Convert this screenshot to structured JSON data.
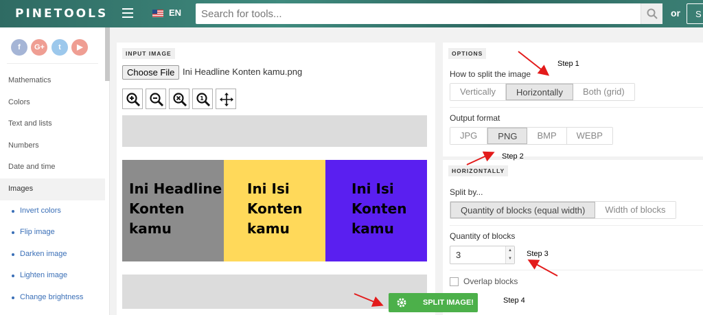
{
  "header": {
    "logo": "PINETOOLS",
    "language": "EN",
    "search_placeholder": "Search for tools...",
    "or_label": "or",
    "signup_label": "S"
  },
  "sidebar": {
    "socials": [
      {
        "name": "facebook",
        "glyph": "f"
      },
      {
        "name": "google-plus",
        "glyph": "G+"
      },
      {
        "name": "twitter",
        "glyph": "t"
      },
      {
        "name": "youtube",
        "glyph": "▶"
      }
    ],
    "items": [
      {
        "label": "Mathematics"
      },
      {
        "label": "Colors"
      },
      {
        "label": "Text and lists"
      },
      {
        "label": "Numbers"
      },
      {
        "label": "Date and time"
      },
      {
        "label": "Images"
      },
      {
        "label": "Invert colors"
      },
      {
        "label": "Flip image"
      },
      {
        "label": "Darken image"
      },
      {
        "label": "Lighten image"
      },
      {
        "label": "Change brightness"
      }
    ]
  },
  "input": {
    "section_title": "INPUT IMAGE",
    "choose_file": "Choose File",
    "file_name": "Ini Headline Konten kamu.png",
    "tools": [
      "zoom-in-icon",
      "zoom-out-icon",
      "zoom-reset-icon",
      "zoom-fit-icon",
      "move-icon"
    ],
    "preview_blocks": [
      {
        "lines": [
          "Ini Headline",
          "Konten",
          "kamu"
        ],
        "color": "#8c8c8c"
      },
      {
        "lines": [
          "Ini Isi",
          "Konten",
          "kamu"
        ],
        "color": "#ffd95a"
      },
      {
        "lines": [
          "Ini Isi",
          "Konten",
          "kamu"
        ],
        "color": "#5a1ff0"
      }
    ]
  },
  "options": {
    "section_title": "OPTIONS",
    "split_label": "How to split the image",
    "split_options": [
      "Vertically",
      "Horizontally",
      "Both (grid)"
    ],
    "split_selected": "Horizontally",
    "format_label": "Output format",
    "format_options": [
      "JPG",
      "PNG",
      "BMP",
      "WEBP"
    ],
    "format_selected": "PNG"
  },
  "horizontally": {
    "section_title": "HORIZONTALLY",
    "split_by_label": "Split by...",
    "split_by_options": [
      "Quantity of blocks (equal width)",
      "Width of blocks"
    ],
    "split_by_selected": "Quantity of blocks (equal width)",
    "qty_label": "Quantity of blocks",
    "qty_value": "3",
    "overlap_label": "Overlap blocks"
  },
  "action": {
    "split_label": "SPLIT IMAGE!"
  },
  "steps": [
    "Step 1",
    "Step 2",
    "Step 3",
    "Step 4"
  ],
  "colors": {
    "accent_green": "#4cb04a",
    "arrow_red": "#e31b1b",
    "header_teal": "#2f6b63"
  }
}
